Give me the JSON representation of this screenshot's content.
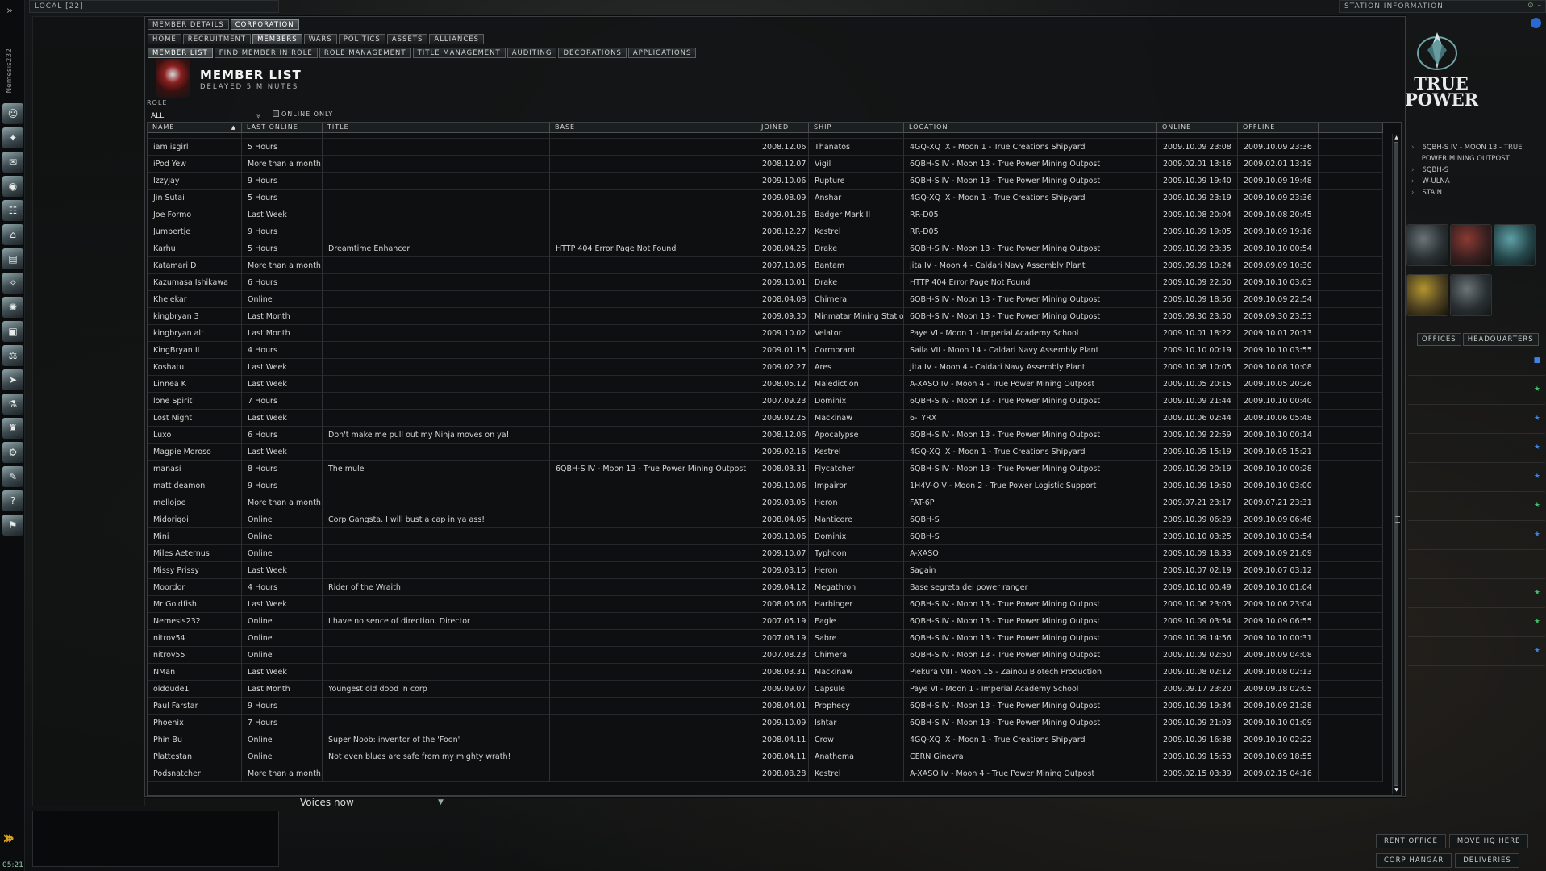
{
  "neocom": {
    "pilot": "Nemesis232",
    "clock": "05:21"
  },
  "local": {
    "title": "LOCAL [22]",
    "voices": "Voices now"
  },
  "station": {
    "title": "STATION INFORMATION",
    "corp_name_line1": "TRUE",
    "corp_name_line2": "POWER",
    "info": [
      "6QBH-S IV - MOON 13 - TRUE",
      "POWER MINING OUTPOST",
      "6QBH-S",
      "W-ULNA",
      "STAIN"
    ],
    "tabs": [
      "OFFICES",
      "HEADQUARTERS"
    ],
    "buttons": [
      "RENT OFFICE",
      "MOVE HQ HERE",
      "CORP HANGAR",
      "DELIVERIES"
    ]
  },
  "corp": {
    "tabs_row1": [
      "MEMBER DETAILS",
      "CORPORATION"
    ],
    "tabs_row2": [
      "HOME",
      "RECRUITMENT",
      "MEMBERS",
      "WARS",
      "POLITICS",
      "ASSETS",
      "ALLIANCES"
    ],
    "tabs_row3": [
      "MEMBER LIST",
      "FIND MEMBER IN ROLE",
      "ROLE MANAGEMENT",
      "TITLE MANAGEMENT",
      "AUDITING",
      "DECORATIONS",
      "APPLICATIONS"
    ],
    "heading": "MEMBER LIST",
    "subheading": "DELAYED 5 MINUTES",
    "role_label": "ROLE",
    "role_value": "ALL",
    "online_only": "ONLINE ONLY",
    "columns": [
      "NAME",
      "LAST ONLINE",
      "TITLE",
      "BASE",
      "JOINED",
      "SHIP",
      "LOCATION",
      "ONLINE",
      "OFFLINE",
      ""
    ],
    "rows": [
      [
        "iam isgirl",
        "5 Hours",
        "",
        "",
        "2008.12.06",
        "Thanatos",
        "4GQ-XQ IX - Moon 1 - True Creations Shipyard",
        "2009.10.09 23:08",
        "2009.10.09 23:36"
      ],
      [
        "iPod Yew",
        "More than a month",
        "",
        "",
        "2008.12.07",
        "Vigil",
        "6QBH-S IV - Moon 13 - True Power Mining Outpost",
        "2009.02.01 13:16",
        "2009.02.01 13:19"
      ],
      [
        "Izzyjay",
        "9 Hours",
        "",
        "",
        "2009.10.06",
        "Rupture",
        "6QBH-S IV - Moon 13 - True Power Mining Outpost",
        "2009.10.09 19:40",
        "2009.10.09 19:48"
      ],
      [
        "Jin Sutai",
        "5 Hours",
        "",
        "",
        "2009.08.09",
        "Anshar",
        "4GQ-XQ IX - Moon 1 - True Creations Shipyard",
        "2009.10.09 23:19",
        "2009.10.09 23:36"
      ],
      [
        "Joe Formo",
        "Last Week",
        "",
        "",
        "2009.01.26",
        "Badger Mark II",
        "RR-D05",
        "2009.10.08 20:04",
        "2009.10.08 20:45"
      ],
      [
        "Jumpertje",
        "9 Hours",
        "",
        "",
        "2008.12.27",
        "Kestrel",
        "RR-D05",
        "2009.10.09 19:05",
        "2009.10.09 19:16"
      ],
      [
        "Karhu",
        "5 Hours",
        "Dreamtime Enhancer",
        "HTTP 404 Error Page Not Found",
        "2008.04.25",
        "Drake",
        "6QBH-S IV - Moon 13 - True Power Mining Outpost",
        "2009.10.09 23:35",
        "2009.10.10 00:54"
      ],
      [
        "Katamari D",
        "More than a month",
        "",
        "",
        "2007.10.05",
        "Bantam",
        "Jita IV - Moon 4 - Caldari Navy Assembly Plant",
        "2009.09.09 10:24",
        "2009.09.09 10:30"
      ],
      [
        "Kazumasa Ishikawa",
        "6 Hours",
        "",
        "",
        "2009.10.01",
        "Drake",
        "HTTP 404 Error Page Not Found",
        "2009.10.09 22:50",
        "2009.10.10 03:03"
      ],
      [
        "Khelekar",
        "Online",
        "",
        "",
        "2008.04.08",
        "Chimera",
        "6QBH-S IV - Moon 13 - True Power Mining Outpost",
        "2009.10.09 18:56",
        "2009.10.09 22:54"
      ],
      [
        "kingbryan 3",
        "Last Month",
        "",
        "",
        "2009.09.30",
        "Minmatar Mining Station",
        "6QBH-S IV - Moon 13 - True Power Mining Outpost",
        "2009.09.30 23:50",
        "2009.09.30 23:53"
      ],
      [
        "kingbryan alt",
        "Last Month",
        "",
        "",
        "2009.10.02",
        "Velator",
        "Paye VI - Moon 1 - Imperial Academy School",
        "2009.10.01 18:22",
        "2009.10.01 20:13"
      ],
      [
        "KingBryan II",
        "4 Hours",
        "",
        "",
        "2009.01.15",
        "Cormorant",
        "Saila VII - Moon 14 - Caldari Navy Assembly Plant",
        "2009.10.10 00:19",
        "2009.10.10 03:55"
      ],
      [
        "Koshatul",
        "Last Week",
        "",
        "",
        "2009.02.27",
        "Ares",
        "Jita IV - Moon 4 - Caldari Navy Assembly Plant",
        "2009.10.08 10:05",
        "2009.10.08 10:08"
      ],
      [
        "Linnea K",
        "Last Week",
        "",
        "",
        "2008.05.12",
        "Malediction",
        "A-XASO IV - Moon 4 - True Power Mining Outpost",
        "2009.10.05 20:15",
        "2009.10.05 20:26"
      ],
      [
        "lone Spirit",
        "7 Hours",
        "",
        "",
        "2007.09.23",
        "Dominix",
        "6QBH-S IV - Moon 13 - True Power Mining Outpost",
        "2009.10.09 21:44",
        "2009.10.10 00:40"
      ],
      [
        "Lost Night",
        "Last Week",
        "",
        "",
        "2009.02.25",
        "Mackinaw",
        "6-TYRX",
        "2009.10.06 02:44",
        "2009.10.06 05:48"
      ],
      [
        "Luxo",
        "6 Hours",
        "Don't make me pull out my Ninja moves on ya!",
        "",
        "2008.12.06",
        "Apocalypse",
        "6QBH-S IV - Moon 13 - True Power Mining Outpost",
        "2009.10.09 22:59",
        "2009.10.10 00:14"
      ],
      [
        "Magpie Moroso",
        "Last Week",
        "",
        "",
        "2009.02.16",
        "Kestrel",
        "4GQ-XQ IX - Moon 1 - True Creations Shipyard",
        "2009.10.05 15:19",
        "2009.10.05 15:21"
      ],
      [
        "manasi",
        "8 Hours",
        "The mule",
        "6QBH-S IV - Moon 13 - True Power Mining Outpost",
        "2008.03.31",
        "Flycatcher",
        "6QBH-S IV - Moon 13 - True Power Mining Outpost",
        "2009.10.09 20:19",
        "2009.10.10 00:28"
      ],
      [
        "matt deamon",
        "9 Hours",
        "",
        "",
        "2009.10.06",
        "Impairor",
        "1H4V-O V - Moon 2 - True Power Logistic Support",
        "2009.10.09 19:50",
        "2009.10.10 03:00"
      ],
      [
        "mellojoe",
        "More than a month",
        "",
        "",
        "2009.03.05",
        "Heron",
        "FAT-6P",
        "2009.07.21 23:17",
        "2009.07.21 23:31"
      ],
      [
        "Midorigoi",
        "Online",
        "Corp Gangsta. I will bust a cap in ya ass!",
        "",
        "2008.04.05",
        "Manticore",
        "6QBH-S",
        "2009.10.09 06:29",
        "2009.10.09 06:48"
      ],
      [
        "Mini",
        "Online",
        "",
        "",
        "2009.10.06",
        "Dominix",
        "6QBH-S",
        "2009.10.10 03:25",
        "2009.10.10 03:54"
      ],
      [
        "Miles Aeternus",
        "Online",
        "",
        "",
        "2009.10.07",
        "Typhoon",
        "A-XASO",
        "2009.10.09 18:33",
        "2009.10.09 21:09"
      ],
      [
        "Missy Prissy",
        "Last Week",
        "",
        "",
        "2009.03.15",
        "Heron",
        "Sagain",
        "2009.10.07 02:19",
        "2009.10.07 03:12"
      ],
      [
        "Moordor",
        "4 Hours",
        "Rider of the Wraith",
        "",
        "2009.04.12",
        "Megathron",
        "Base segreta dei power ranger",
        "2009.10.10 00:49",
        "2009.10.10 01:04"
      ],
      [
        "Mr Goldfish",
        "Last Week",
        "",
        "",
        "2008.05.06",
        "Harbinger",
        "6QBH-S IV - Moon 13 - True Power Mining Outpost",
        "2009.10.06 23:03",
        "2009.10.06 23:04"
      ],
      [
        "Nemesis232",
        "Online",
        "I have no sence of direction. Director",
        "",
        "2007.05.19",
        "Eagle",
        "6QBH-S IV - Moon 13 - True Power Mining Outpost",
        "2009.10.09 03:54",
        "2009.10.09 06:55"
      ],
      [
        "nitrov54",
        "Online",
        "",
        "",
        "2007.08.19",
        "Sabre",
        "6QBH-S IV - Moon 13 - True Power Mining Outpost",
        "2009.10.09 14:56",
        "2009.10.10 00:31"
      ],
      [
        "nitrov55",
        "Online",
        "",
        "",
        "2007.08.23",
        "Chimera",
        "6QBH-S IV - Moon 13 - True Power Mining Outpost",
        "2009.10.09 02:50",
        "2009.10.09 04:08"
      ],
      [
        "NMan",
        "Last Week",
        "",
        "",
        "2008.03.31",
        "Mackinaw",
        "Piekura VIII - Moon 15 - Zainou Biotech Production",
        "2009.10.08 02:12",
        "2009.10.08 02:13"
      ],
      [
        "olddude1",
        "Last Month",
        "Youngest old dood in corp",
        "",
        "2009.09.07",
        "Capsule",
        "Paye VI - Moon 1 - Imperial Academy School",
        "2009.09.17 23:20",
        "2009.09.18 02:05"
      ],
      [
        "Paul Farstar",
        "9 Hours",
        "",
        "",
        "2008.04.01",
        "Prophecy",
        "6QBH-S IV - Moon 13 - True Power Mining Outpost",
        "2009.10.09 19:34",
        "2009.10.09 21:28"
      ],
      [
        "Phoenix",
        "7 Hours",
        "",
        "",
        "2009.10.09",
        "Ishtar",
        "6QBH-S IV - Moon 13 - True Power Mining Outpost",
        "2009.10.09 21:03",
        "2009.10.10 01:09"
      ],
      [
        "Phin Bu",
        "Online",
        "Super Noob: inventor of the 'Foon'",
        "",
        "2008.04.11",
        "Crow",
        "4GQ-XQ IX - Moon 1 - True Creations Shipyard",
        "2009.10.09 16:38",
        "2009.10.10 02:22"
      ],
      [
        "Plattestan",
        "Online",
        "Not even blues are safe from my mighty wrath!",
        "",
        "2008.04.11",
        "Anathema",
        "CERN Ginevra",
        "2009.10.09 15:53",
        "2009.10.09 18:55"
      ],
      [
        "Podsnatcher",
        "More than a month",
        "",
        "",
        "2008.08.28",
        "Kestrel",
        "A-XASO IV - Moon 4 - True Power Mining Outpost",
        "2009.02.15 03:39",
        "2009.02.15 04:16"
      ]
    ]
  }
}
